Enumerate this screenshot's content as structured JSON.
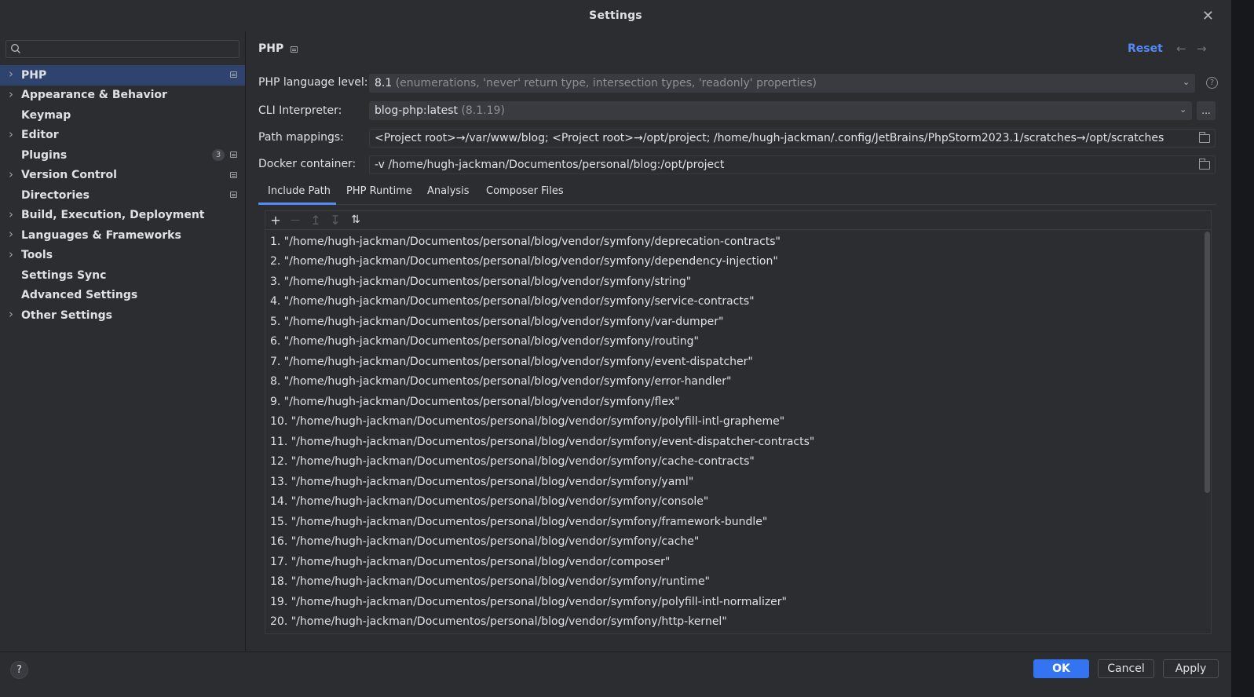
{
  "window": {
    "title": "Settings",
    "close_glyph": "✕"
  },
  "sidebar": {
    "search_placeholder": "",
    "items": [
      {
        "label": "PHP",
        "expandable": true,
        "selected": true,
        "marker": true
      },
      {
        "label": "Appearance & Behavior",
        "expandable": true
      },
      {
        "label": "Keymap",
        "expandable": false
      },
      {
        "label": "Editor",
        "expandable": true
      },
      {
        "label": "Plugins",
        "expandable": false,
        "badge": "3",
        "marker": true
      },
      {
        "label": "Version Control",
        "expandable": true,
        "marker": true
      },
      {
        "label": "Directories",
        "expandable": false,
        "marker": true
      },
      {
        "label": "Build, Execution, Deployment",
        "expandable": true
      },
      {
        "label": "Languages & Frameworks",
        "expandable": true
      },
      {
        "label": "Tools",
        "expandable": true
      },
      {
        "label": "Settings Sync",
        "expandable": false
      },
      {
        "label": "Advanced Settings",
        "expandable": false
      },
      {
        "label": "Other Settings",
        "expandable": true
      }
    ]
  },
  "page": {
    "title": "PHP",
    "reset_label": "Reset",
    "back_glyph": "←",
    "forward_glyph": "→",
    "language_level": {
      "label": "PHP language level:",
      "value": "8.1",
      "detail": "(enumerations, 'never' return type, intersection types, 'readonly' properties)"
    },
    "cli_interpreter": {
      "label": "CLI Interpreter:",
      "value": "blog-php:latest",
      "detail": "(8.1.19)",
      "more_label": "..."
    },
    "path_mappings": {
      "label": "Path mappings:",
      "value": "<Project root>→/var/www/blog; <Project root>→/opt/project; /home/hugh-jackman/.config/JetBrains/PhpStorm2023.1/scratches→/opt/scratches"
    },
    "docker_container": {
      "label": "Docker container:",
      "value": "-v /home/hugh-jackman/Documentos/personal/blog:/opt/project"
    },
    "tabs": [
      "Include Path",
      "PHP Runtime",
      "Analysis",
      "Composer Files"
    ],
    "active_tab": "Include Path",
    "include_paths": [
      "1. \"/home/hugh-jackman/Documentos/personal/blog/vendor/symfony/deprecation-contracts\"",
      "2. \"/home/hugh-jackman/Documentos/personal/blog/vendor/symfony/dependency-injection\"",
      "3. \"/home/hugh-jackman/Documentos/personal/blog/vendor/symfony/string\"",
      "4. \"/home/hugh-jackman/Documentos/personal/blog/vendor/symfony/service-contracts\"",
      "5. \"/home/hugh-jackman/Documentos/personal/blog/vendor/symfony/var-dumper\"",
      "6. \"/home/hugh-jackman/Documentos/personal/blog/vendor/symfony/routing\"",
      "7. \"/home/hugh-jackman/Documentos/personal/blog/vendor/symfony/event-dispatcher\"",
      "8. \"/home/hugh-jackman/Documentos/personal/blog/vendor/symfony/error-handler\"",
      "9. \"/home/hugh-jackman/Documentos/personal/blog/vendor/symfony/flex\"",
      "10. \"/home/hugh-jackman/Documentos/personal/blog/vendor/symfony/polyfill-intl-grapheme\"",
      "11. \"/home/hugh-jackman/Documentos/personal/blog/vendor/symfony/event-dispatcher-contracts\"",
      "12. \"/home/hugh-jackman/Documentos/personal/blog/vendor/symfony/cache-contracts\"",
      "13. \"/home/hugh-jackman/Documentos/personal/blog/vendor/symfony/yaml\"",
      "14. \"/home/hugh-jackman/Documentos/personal/blog/vendor/symfony/console\"",
      "15. \"/home/hugh-jackman/Documentos/personal/blog/vendor/symfony/framework-bundle\"",
      "16. \"/home/hugh-jackman/Documentos/personal/blog/vendor/symfony/cache\"",
      "17. \"/home/hugh-jackman/Documentos/personal/blog/vendor/composer\"",
      "18. \"/home/hugh-jackman/Documentos/personal/blog/vendor/symfony/runtime\"",
      "19. \"/home/hugh-jackman/Documentos/personal/blog/vendor/symfony/polyfill-intl-normalizer\"",
      "20. \"/home/hugh-jackman/Documentos/personal/blog/vendor/symfony/http-kernel\""
    ]
  },
  "toolbar": {
    "add": "+",
    "remove": "—",
    "up": "↥",
    "down": "↧",
    "sort": "⇅"
  },
  "footer": {
    "help": "?",
    "ok": "OK",
    "cancel": "Cancel",
    "apply": "Apply"
  },
  "colors": {
    "accent": "#3574f0",
    "selection": "#2e436e",
    "link": "#548af7"
  }
}
